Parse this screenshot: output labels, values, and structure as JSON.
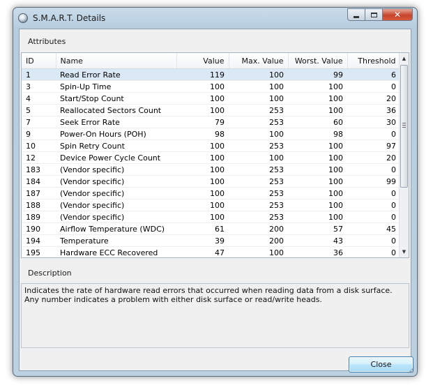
{
  "window": {
    "title": "S.M.A.R.T. Details"
  },
  "attributes": {
    "label": "Attributes",
    "columns": {
      "id": "ID",
      "name": "Name",
      "value": "Value",
      "max_value": "Max. Value",
      "worst_value": "Worst. Value",
      "threshold": "Threshold"
    },
    "rows": [
      {
        "id": "1",
        "name": "Read Error Rate",
        "value": "119",
        "max": "100",
        "worst": "99",
        "threshold": "6"
      },
      {
        "id": "3",
        "name": "Spin-Up Time",
        "value": "100",
        "max": "100",
        "worst": "100",
        "threshold": "0"
      },
      {
        "id": "4",
        "name": "Start/Stop Count",
        "value": "100",
        "max": "100",
        "worst": "100",
        "threshold": "20"
      },
      {
        "id": "5",
        "name": "Reallocated Sectors Count",
        "value": "100",
        "max": "253",
        "worst": "100",
        "threshold": "36"
      },
      {
        "id": "7",
        "name": "Seek Error Rate",
        "value": "79",
        "max": "253",
        "worst": "60",
        "threshold": "30"
      },
      {
        "id": "9",
        "name": "Power-On Hours (POH)",
        "value": "98",
        "max": "100",
        "worst": "98",
        "threshold": "0"
      },
      {
        "id": "10",
        "name": "Spin Retry Count",
        "value": "100",
        "max": "253",
        "worst": "100",
        "threshold": "97"
      },
      {
        "id": "12",
        "name": "Device Power Cycle Count",
        "value": "100",
        "max": "100",
        "worst": "100",
        "threshold": "20"
      },
      {
        "id": "183",
        "name": "(Vendor specific)",
        "value": "100",
        "max": "253",
        "worst": "100",
        "threshold": "0"
      },
      {
        "id": "184",
        "name": "(Vendor specific)",
        "value": "100",
        "max": "253",
        "worst": "100",
        "threshold": "99"
      },
      {
        "id": "187",
        "name": "(Vendor specific)",
        "value": "100",
        "max": "253",
        "worst": "100",
        "threshold": "0"
      },
      {
        "id": "188",
        "name": "(Vendor specific)",
        "value": "100",
        "max": "253",
        "worst": "100",
        "threshold": "0"
      },
      {
        "id": "189",
        "name": "(Vendor specific)",
        "value": "100",
        "max": "253",
        "worst": "100",
        "threshold": "0"
      },
      {
        "id": "190",
        "name": "Airflow Temperature (WDC)",
        "value": "61",
        "max": "200",
        "worst": "57",
        "threshold": "45"
      },
      {
        "id": "194",
        "name": "Temperature",
        "value": "39",
        "max": "200",
        "worst": "43",
        "threshold": "0"
      },
      {
        "id": "195",
        "name": "Hardware ECC Recovered",
        "value": "47",
        "max": "100",
        "worst": "36",
        "threshold": "0"
      }
    ]
  },
  "description": {
    "label": "Description",
    "text": "Indicates the rate of hardware read errors that occurred when reading data from a disk surface. Any number indicates a problem with either disk surface or read/write heads."
  },
  "buttons": {
    "close": "Close"
  },
  "icons": {
    "app": "disk-info-icon",
    "minimize": "minimize-icon",
    "maximize": "maximize-icon",
    "close_window": "close-icon",
    "scroll_up": "scroll-up-arrow-icon",
    "scroll_down": "scroll-down-arrow-icon"
  },
  "colors": {
    "selection": "#dbe8f5",
    "close_button": "#c7442c",
    "button_border": "#3c7fb1"
  }
}
